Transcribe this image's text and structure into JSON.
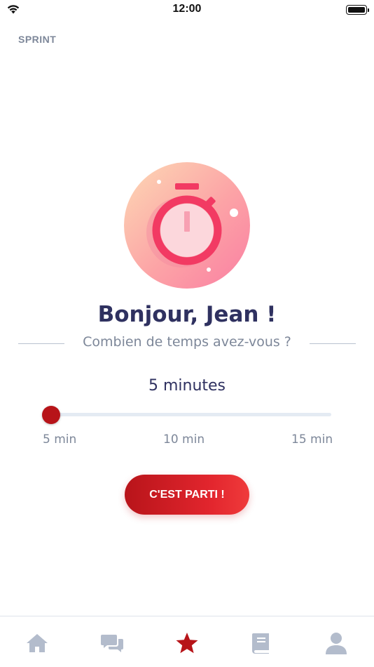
{
  "status_bar": {
    "time": "12:00"
  },
  "header": {
    "label": "SPRINT"
  },
  "greeting": "Bonjour, Jean !",
  "question": "Combien de temps avez-vous ?",
  "duration": {
    "selected_label": "5 minutes",
    "selected_fraction": 0.0,
    "min_label": "5 min",
    "mid_label": "10 min",
    "max_label": "15 min"
  },
  "cta": {
    "label": "C'EST PARTI !"
  },
  "tabs": [
    {
      "name": "home",
      "icon": "home-icon"
    },
    {
      "name": "chat",
      "icon": "chat-icon"
    },
    {
      "name": "sprint",
      "icon": "star-icon",
      "active": true
    },
    {
      "name": "library",
      "icon": "book-icon"
    },
    {
      "name": "profile",
      "icon": "profile-icon"
    }
  ],
  "colors": {
    "accent": "#b71419",
    "tab_inactive": "#b3bccc",
    "title": "#2f3160",
    "muted": "#7d8799"
  }
}
